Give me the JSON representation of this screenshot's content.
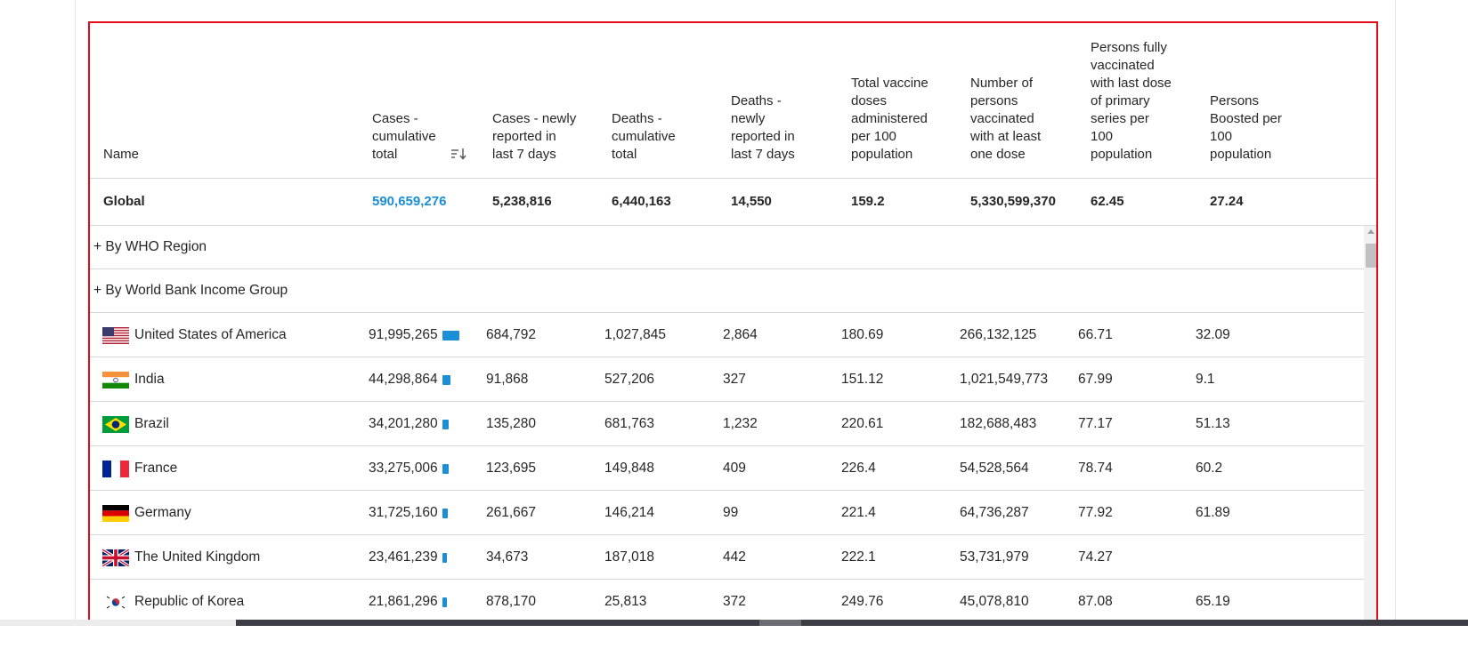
{
  "table": {
    "headers": {
      "name": "Name",
      "cases_cumulative": [
        "Cases -",
        "cumulative",
        "total"
      ],
      "cases_new": [
        "Cases - newly",
        "reported in",
        "last 7 days"
      ],
      "deaths_cumulative": [
        "Deaths -",
        "cumulative",
        "total"
      ],
      "deaths_new": [
        "Deaths -",
        "newly",
        "reported in",
        "last 7 days"
      ],
      "vaccine_doses": [
        "Total vaccine",
        "doses",
        "administered",
        "per 100",
        "population"
      ],
      "persons_vaccinated": [
        "Number of",
        "persons",
        "vaccinated",
        "with at least",
        "one dose"
      ],
      "fully_vaccinated": [
        "Persons fully",
        "vaccinated",
        "with last dose",
        "of primary",
        "series per",
        "100",
        "population"
      ],
      "boosted": [
        "Persons",
        "Boosted per",
        "100",
        "population"
      ]
    },
    "sort_icon": "sort-descending-icon",
    "global": {
      "name": "Global",
      "cases_cumulative": "590,659,276",
      "cases_new": "5,238,816",
      "deaths_cumulative": "6,440,163",
      "deaths_new": "14,550",
      "vaccine_doses": "159.2",
      "persons_vaccinated": "5,330,599,370",
      "fully_vaccinated": "62.45",
      "boosted": "27.24"
    },
    "groups": [
      "+ By WHO Region",
      "+ By World Bank Income Group"
    ],
    "rows": [
      {
        "name": "United States of America",
        "flag": "usa-flag-icon",
        "cases": "91,995,265",
        "bar_fraction": 1.0,
        "cases_new": "684,792",
        "deaths": "1,027,845",
        "deaths_new": "2,864",
        "doses": "180.69",
        "vaccinated": "266,132,125",
        "fully": "66.71",
        "boosted": "32.09"
      },
      {
        "name": "India",
        "flag": "india-flag-icon",
        "cases": "44,298,864",
        "bar_fraction": 0.48,
        "cases_new": "91,868",
        "deaths": "527,206",
        "deaths_new": "327",
        "doses": "151.12",
        "vaccinated": "1,021,549,773",
        "fully": "67.99",
        "boosted": "9.1"
      },
      {
        "name": "Brazil",
        "flag": "brazil-flag-icon",
        "cases": "34,201,280",
        "bar_fraction": 0.37,
        "cases_new": "135,280",
        "deaths": "681,763",
        "deaths_new": "1,232",
        "doses": "220.61",
        "vaccinated": "182,688,483",
        "fully": "77.17",
        "boosted": "51.13"
      },
      {
        "name": "France",
        "flag": "france-flag-icon",
        "cases": "33,275,006",
        "bar_fraction": 0.36,
        "cases_new": "123,695",
        "deaths": "149,848",
        "deaths_new": "409",
        "doses": "226.4",
        "vaccinated": "54,528,564",
        "fully": "78.74",
        "boosted": "60.2"
      },
      {
        "name": "Germany",
        "flag": "germany-flag-icon",
        "cases": "31,725,160",
        "bar_fraction": 0.34,
        "cases_new": "261,667",
        "deaths": "146,214",
        "deaths_new": "99",
        "doses": "221.4",
        "vaccinated": "64,736,287",
        "fully": "77.92",
        "boosted": "61.89"
      },
      {
        "name": "The United Kingdom",
        "flag": "uk-flag-icon",
        "cases": "23,461,239",
        "bar_fraction": 0.25,
        "cases_new": "34,673",
        "deaths": "187,018",
        "deaths_new": "442",
        "doses": "222.1",
        "vaccinated": "53,731,979",
        "fully": "74.27",
        "boosted": ""
      },
      {
        "name": "Republic of Korea",
        "flag": "korea-flag-icon",
        "cases": "21,861,296",
        "bar_fraction": 0.24,
        "cases_new": "878,170",
        "deaths": "25,813",
        "deaths_new": "372",
        "doses": "249.76",
        "vaccinated": "45,078,810",
        "fully": "87.08",
        "boosted": "65.19"
      }
    ]
  },
  "colors": {
    "accent": "#1a8fd6",
    "highlight_border": "#e30b17",
    "row_divider": "#d8d8d8"
  }
}
